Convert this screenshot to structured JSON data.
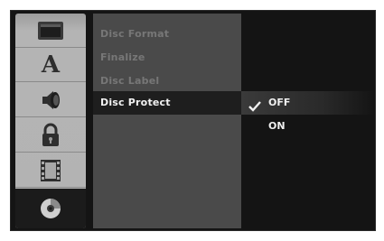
{
  "sidebar": {
    "icons": [
      {
        "name": "tv-screen-icon"
      },
      {
        "name": "language-letter-icon",
        "glyph": "A"
      },
      {
        "name": "speaker-audio-icon"
      },
      {
        "name": "padlock-icon"
      },
      {
        "name": "film-strip-icon"
      },
      {
        "name": "disc-icon"
      }
    ],
    "active_index": 5
  },
  "menu": {
    "items": [
      {
        "label": "Disc Format"
      },
      {
        "label": "Finalize"
      },
      {
        "label": "Disc Label"
      },
      {
        "label": "Disc Protect"
      }
    ],
    "active_index": 3
  },
  "options": {
    "items": [
      {
        "label": "OFF",
        "checked": true
      },
      {
        "label": "ON",
        "checked": false
      }
    ]
  },
  "colors": {
    "screen_bg": "#141414",
    "sidebar_bg": "#b3b3b3",
    "menu_panel_bg": "#4a4a4a",
    "highlight_bg": "#1e1e1e",
    "inactive_text": "#777777",
    "active_text": "#f2f2f2"
  }
}
